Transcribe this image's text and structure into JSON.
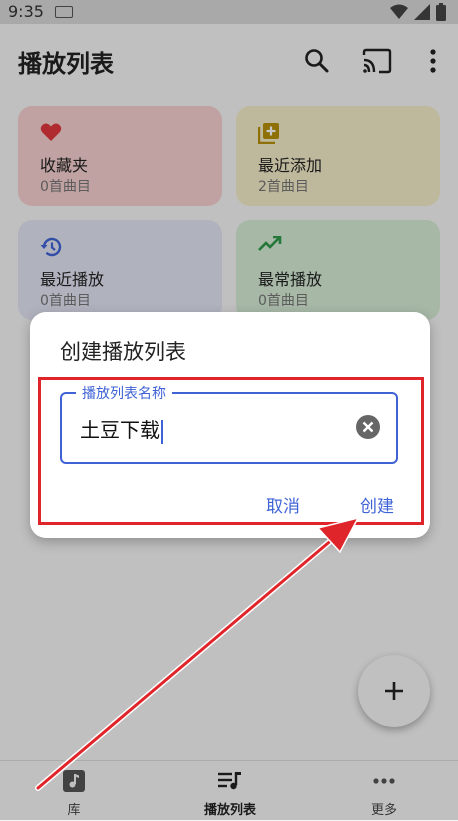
{
  "status_bar": {
    "time": "9:35"
  },
  "header": {
    "title": "播放列表"
  },
  "cards": [
    {
      "name": "收藏夹",
      "count": "0首曲目",
      "icon": "heart-icon",
      "color": "#f6d0d0",
      "icon_color": "#e0383e"
    },
    {
      "name": "最近添加",
      "count": "2首曲目",
      "icon": "add-to-queue-icon",
      "color": "#f4ecc8",
      "icon_color": "#b8900a"
    },
    {
      "name": "最近播放",
      "count": "0首曲目",
      "icon": "history-icon",
      "color": "#e2e4f4",
      "icon_color": "#3f63d6"
    },
    {
      "name": "最常播放",
      "count": "0首曲目",
      "icon": "trending-up-icon",
      "color": "#d6ecd6",
      "icon_color": "#2f9a4a"
    }
  ],
  "dialog": {
    "title": "创建播放列表",
    "field_label": "播放列表名称",
    "field_value": "土豆下载",
    "cancel_label": "取消",
    "create_label": "创建"
  },
  "bottom_nav": [
    {
      "label": "库",
      "icon": "music-note-icon"
    },
    {
      "label": "播放列表",
      "icon": "playlist-icon"
    },
    {
      "label": "更多",
      "icon": "more-horizontal-icon"
    }
  ],
  "colors": {
    "accent": "#3f63d6",
    "annotation": "#e0252a"
  }
}
